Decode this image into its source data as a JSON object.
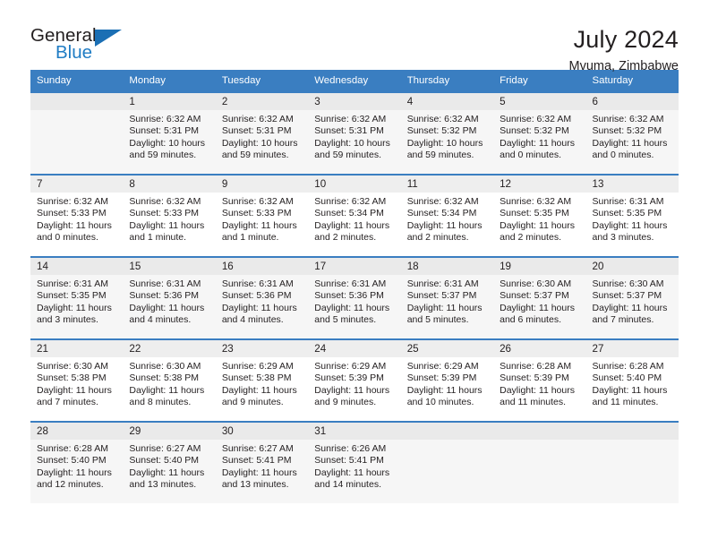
{
  "logo": {
    "word_top": "General",
    "word_bottom": "Blue",
    "accent_color": "#1b6fb4"
  },
  "header": {
    "title": "July 2024",
    "subtitle": "Mvuma, Zimbabwe"
  },
  "calendar": {
    "header_bg": "#3a7ec1",
    "weekdays": [
      "Sunday",
      "Monday",
      "Tuesday",
      "Wednesday",
      "Thursday",
      "Friday",
      "Saturday"
    ],
    "weeks": [
      [
        {
          "day": "",
          "lines": []
        },
        {
          "day": "1",
          "lines": [
            "Sunrise: 6:32 AM",
            "Sunset: 5:31 PM",
            "Daylight: 10 hours",
            "and 59 minutes."
          ]
        },
        {
          "day": "2",
          "lines": [
            "Sunrise: 6:32 AM",
            "Sunset: 5:31 PM",
            "Daylight: 10 hours",
            "and 59 minutes."
          ]
        },
        {
          "day": "3",
          "lines": [
            "Sunrise: 6:32 AM",
            "Sunset: 5:31 PM",
            "Daylight: 10 hours",
            "and 59 minutes."
          ]
        },
        {
          "day": "4",
          "lines": [
            "Sunrise: 6:32 AM",
            "Sunset: 5:32 PM",
            "Daylight: 10 hours",
            "and 59 minutes."
          ]
        },
        {
          "day": "5",
          "lines": [
            "Sunrise: 6:32 AM",
            "Sunset: 5:32 PM",
            "Daylight: 11 hours",
            "and 0 minutes."
          ]
        },
        {
          "day": "6",
          "lines": [
            "Sunrise: 6:32 AM",
            "Sunset: 5:32 PM",
            "Daylight: 11 hours",
            "and 0 minutes."
          ]
        }
      ],
      [
        {
          "day": "7",
          "lines": [
            "Sunrise: 6:32 AM",
            "Sunset: 5:33 PM",
            "Daylight: 11 hours",
            "and 0 minutes."
          ]
        },
        {
          "day": "8",
          "lines": [
            "Sunrise: 6:32 AM",
            "Sunset: 5:33 PM",
            "Daylight: 11 hours",
            "and 1 minute."
          ]
        },
        {
          "day": "9",
          "lines": [
            "Sunrise: 6:32 AM",
            "Sunset: 5:33 PM",
            "Daylight: 11 hours",
            "and 1 minute."
          ]
        },
        {
          "day": "10",
          "lines": [
            "Sunrise: 6:32 AM",
            "Sunset: 5:34 PM",
            "Daylight: 11 hours",
            "and 2 minutes."
          ]
        },
        {
          "day": "11",
          "lines": [
            "Sunrise: 6:32 AM",
            "Sunset: 5:34 PM",
            "Daylight: 11 hours",
            "and 2 minutes."
          ]
        },
        {
          "day": "12",
          "lines": [
            "Sunrise: 6:32 AM",
            "Sunset: 5:35 PM",
            "Daylight: 11 hours",
            "and 2 minutes."
          ]
        },
        {
          "day": "13",
          "lines": [
            "Sunrise: 6:31 AM",
            "Sunset: 5:35 PM",
            "Daylight: 11 hours",
            "and 3 minutes."
          ]
        }
      ],
      [
        {
          "day": "14",
          "lines": [
            "Sunrise: 6:31 AM",
            "Sunset: 5:35 PM",
            "Daylight: 11 hours",
            "and 3 minutes."
          ]
        },
        {
          "day": "15",
          "lines": [
            "Sunrise: 6:31 AM",
            "Sunset: 5:36 PM",
            "Daylight: 11 hours",
            "and 4 minutes."
          ]
        },
        {
          "day": "16",
          "lines": [
            "Sunrise: 6:31 AM",
            "Sunset: 5:36 PM",
            "Daylight: 11 hours",
            "and 4 minutes."
          ]
        },
        {
          "day": "17",
          "lines": [
            "Sunrise: 6:31 AM",
            "Sunset: 5:36 PM",
            "Daylight: 11 hours",
            "and 5 minutes."
          ]
        },
        {
          "day": "18",
          "lines": [
            "Sunrise: 6:31 AM",
            "Sunset: 5:37 PM",
            "Daylight: 11 hours",
            "and 5 minutes."
          ]
        },
        {
          "day": "19",
          "lines": [
            "Sunrise: 6:30 AM",
            "Sunset: 5:37 PM",
            "Daylight: 11 hours",
            "and 6 minutes."
          ]
        },
        {
          "day": "20",
          "lines": [
            "Sunrise: 6:30 AM",
            "Sunset: 5:37 PM",
            "Daylight: 11 hours",
            "and 7 minutes."
          ]
        }
      ],
      [
        {
          "day": "21",
          "lines": [
            "Sunrise: 6:30 AM",
            "Sunset: 5:38 PM",
            "Daylight: 11 hours",
            "and 7 minutes."
          ]
        },
        {
          "day": "22",
          "lines": [
            "Sunrise: 6:30 AM",
            "Sunset: 5:38 PM",
            "Daylight: 11 hours",
            "and 8 minutes."
          ]
        },
        {
          "day": "23",
          "lines": [
            "Sunrise: 6:29 AM",
            "Sunset: 5:38 PM",
            "Daylight: 11 hours",
            "and 9 minutes."
          ]
        },
        {
          "day": "24",
          "lines": [
            "Sunrise: 6:29 AM",
            "Sunset: 5:39 PM",
            "Daylight: 11 hours",
            "and 9 minutes."
          ]
        },
        {
          "day": "25",
          "lines": [
            "Sunrise: 6:29 AM",
            "Sunset: 5:39 PM",
            "Daylight: 11 hours",
            "and 10 minutes."
          ]
        },
        {
          "day": "26",
          "lines": [
            "Sunrise: 6:28 AM",
            "Sunset: 5:39 PM",
            "Daylight: 11 hours",
            "and 11 minutes."
          ]
        },
        {
          "day": "27",
          "lines": [
            "Sunrise: 6:28 AM",
            "Sunset: 5:40 PM",
            "Daylight: 11 hours",
            "and 11 minutes."
          ]
        }
      ],
      [
        {
          "day": "28",
          "lines": [
            "Sunrise: 6:28 AM",
            "Sunset: 5:40 PM",
            "Daylight: 11 hours",
            "and 12 minutes."
          ]
        },
        {
          "day": "29",
          "lines": [
            "Sunrise: 6:27 AM",
            "Sunset: 5:40 PM",
            "Daylight: 11 hours",
            "and 13 minutes."
          ]
        },
        {
          "day": "30",
          "lines": [
            "Sunrise: 6:27 AM",
            "Sunset: 5:41 PM",
            "Daylight: 11 hours",
            "and 13 minutes."
          ]
        },
        {
          "day": "31",
          "lines": [
            "Sunrise: 6:26 AM",
            "Sunset: 5:41 PM",
            "Daylight: 11 hours",
            "and 14 minutes."
          ]
        },
        {
          "day": "",
          "lines": []
        },
        {
          "day": "",
          "lines": []
        },
        {
          "day": "",
          "lines": []
        }
      ]
    ]
  }
}
